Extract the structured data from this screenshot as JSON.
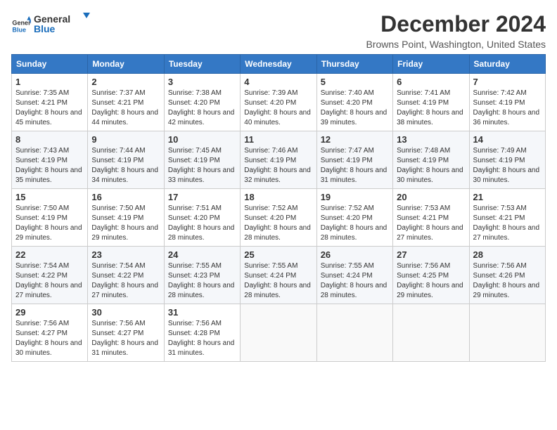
{
  "logo": {
    "line1": "General",
    "line2": "Blue"
  },
  "title": "December 2024",
  "subtitle": "Browns Point, Washington, United States",
  "weekdays": [
    "Sunday",
    "Monday",
    "Tuesday",
    "Wednesday",
    "Thursday",
    "Friday",
    "Saturday"
  ],
  "weeks": [
    [
      {
        "day": "1",
        "sunrise": "7:35 AM",
        "sunset": "4:21 PM",
        "daylight": "8 hours and 45 minutes."
      },
      {
        "day": "2",
        "sunrise": "7:37 AM",
        "sunset": "4:21 PM",
        "daylight": "8 hours and 44 minutes."
      },
      {
        "day": "3",
        "sunrise": "7:38 AM",
        "sunset": "4:20 PM",
        "daylight": "8 hours and 42 minutes."
      },
      {
        "day": "4",
        "sunrise": "7:39 AM",
        "sunset": "4:20 PM",
        "daylight": "8 hours and 40 minutes."
      },
      {
        "day": "5",
        "sunrise": "7:40 AM",
        "sunset": "4:20 PM",
        "daylight": "8 hours and 39 minutes."
      },
      {
        "day": "6",
        "sunrise": "7:41 AM",
        "sunset": "4:19 PM",
        "daylight": "8 hours and 38 minutes."
      },
      {
        "day": "7",
        "sunrise": "7:42 AM",
        "sunset": "4:19 PM",
        "daylight": "8 hours and 36 minutes."
      }
    ],
    [
      {
        "day": "8",
        "sunrise": "7:43 AM",
        "sunset": "4:19 PM",
        "daylight": "8 hours and 35 minutes."
      },
      {
        "day": "9",
        "sunrise": "7:44 AM",
        "sunset": "4:19 PM",
        "daylight": "8 hours and 34 minutes."
      },
      {
        "day": "10",
        "sunrise": "7:45 AM",
        "sunset": "4:19 PM",
        "daylight": "8 hours and 33 minutes."
      },
      {
        "day": "11",
        "sunrise": "7:46 AM",
        "sunset": "4:19 PM",
        "daylight": "8 hours and 32 minutes."
      },
      {
        "day": "12",
        "sunrise": "7:47 AM",
        "sunset": "4:19 PM",
        "daylight": "8 hours and 31 minutes."
      },
      {
        "day": "13",
        "sunrise": "7:48 AM",
        "sunset": "4:19 PM",
        "daylight": "8 hours and 30 minutes."
      },
      {
        "day": "14",
        "sunrise": "7:49 AM",
        "sunset": "4:19 PM",
        "daylight": "8 hours and 30 minutes."
      }
    ],
    [
      {
        "day": "15",
        "sunrise": "7:50 AM",
        "sunset": "4:19 PM",
        "daylight": "8 hours and 29 minutes."
      },
      {
        "day": "16",
        "sunrise": "7:50 AM",
        "sunset": "4:19 PM",
        "daylight": "8 hours and 29 minutes."
      },
      {
        "day": "17",
        "sunrise": "7:51 AM",
        "sunset": "4:20 PM",
        "daylight": "8 hours and 28 minutes."
      },
      {
        "day": "18",
        "sunrise": "7:52 AM",
        "sunset": "4:20 PM",
        "daylight": "8 hours and 28 minutes."
      },
      {
        "day": "19",
        "sunrise": "7:52 AM",
        "sunset": "4:20 PM",
        "daylight": "8 hours and 28 minutes."
      },
      {
        "day": "20",
        "sunrise": "7:53 AM",
        "sunset": "4:21 PM",
        "daylight": "8 hours and 27 minutes."
      },
      {
        "day": "21",
        "sunrise": "7:53 AM",
        "sunset": "4:21 PM",
        "daylight": "8 hours and 27 minutes."
      }
    ],
    [
      {
        "day": "22",
        "sunrise": "7:54 AM",
        "sunset": "4:22 PM",
        "daylight": "8 hours and 27 minutes."
      },
      {
        "day": "23",
        "sunrise": "7:54 AM",
        "sunset": "4:22 PM",
        "daylight": "8 hours and 27 minutes."
      },
      {
        "day": "24",
        "sunrise": "7:55 AM",
        "sunset": "4:23 PM",
        "daylight": "8 hours and 28 minutes."
      },
      {
        "day": "25",
        "sunrise": "7:55 AM",
        "sunset": "4:24 PM",
        "daylight": "8 hours and 28 minutes."
      },
      {
        "day": "26",
        "sunrise": "7:55 AM",
        "sunset": "4:24 PM",
        "daylight": "8 hours and 28 minutes."
      },
      {
        "day": "27",
        "sunrise": "7:56 AM",
        "sunset": "4:25 PM",
        "daylight": "8 hours and 29 minutes."
      },
      {
        "day": "28",
        "sunrise": "7:56 AM",
        "sunset": "4:26 PM",
        "daylight": "8 hours and 29 minutes."
      }
    ],
    [
      {
        "day": "29",
        "sunrise": "7:56 AM",
        "sunset": "4:27 PM",
        "daylight": "8 hours and 30 minutes."
      },
      {
        "day": "30",
        "sunrise": "7:56 AM",
        "sunset": "4:27 PM",
        "daylight": "8 hours and 31 minutes."
      },
      {
        "day": "31",
        "sunrise": "7:56 AM",
        "sunset": "4:28 PM",
        "daylight": "8 hours and 31 minutes."
      },
      null,
      null,
      null,
      null
    ]
  ],
  "labels": {
    "sunrise": "Sunrise:",
    "sunset": "Sunset:",
    "daylight": "Daylight:"
  }
}
